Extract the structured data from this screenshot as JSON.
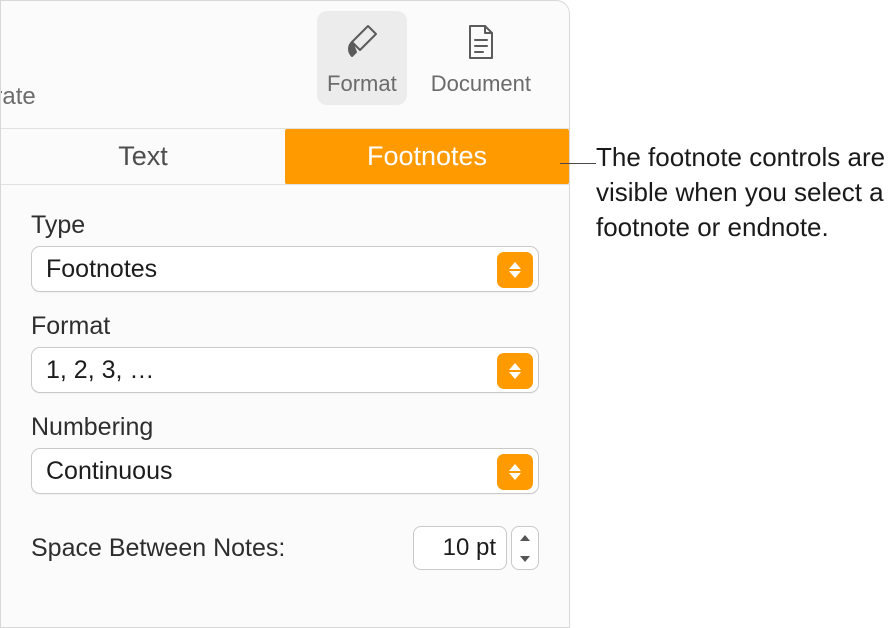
{
  "toolbar": {
    "partial_label": "orate",
    "format_label": "Format",
    "document_label": "Document"
  },
  "tabs": {
    "text_label": "Text",
    "footnotes_label": "Footnotes"
  },
  "fields": {
    "type_label": "Type",
    "type_value": "Footnotes",
    "format_label": "Format",
    "format_value": "1, 2, 3, …",
    "numbering_label": "Numbering",
    "numbering_value": "Continuous",
    "space_label": "Space Between Notes:",
    "space_value": "10 pt"
  },
  "callout": {
    "text": "The footnote controls are visible when you select a footnote or endnote."
  }
}
